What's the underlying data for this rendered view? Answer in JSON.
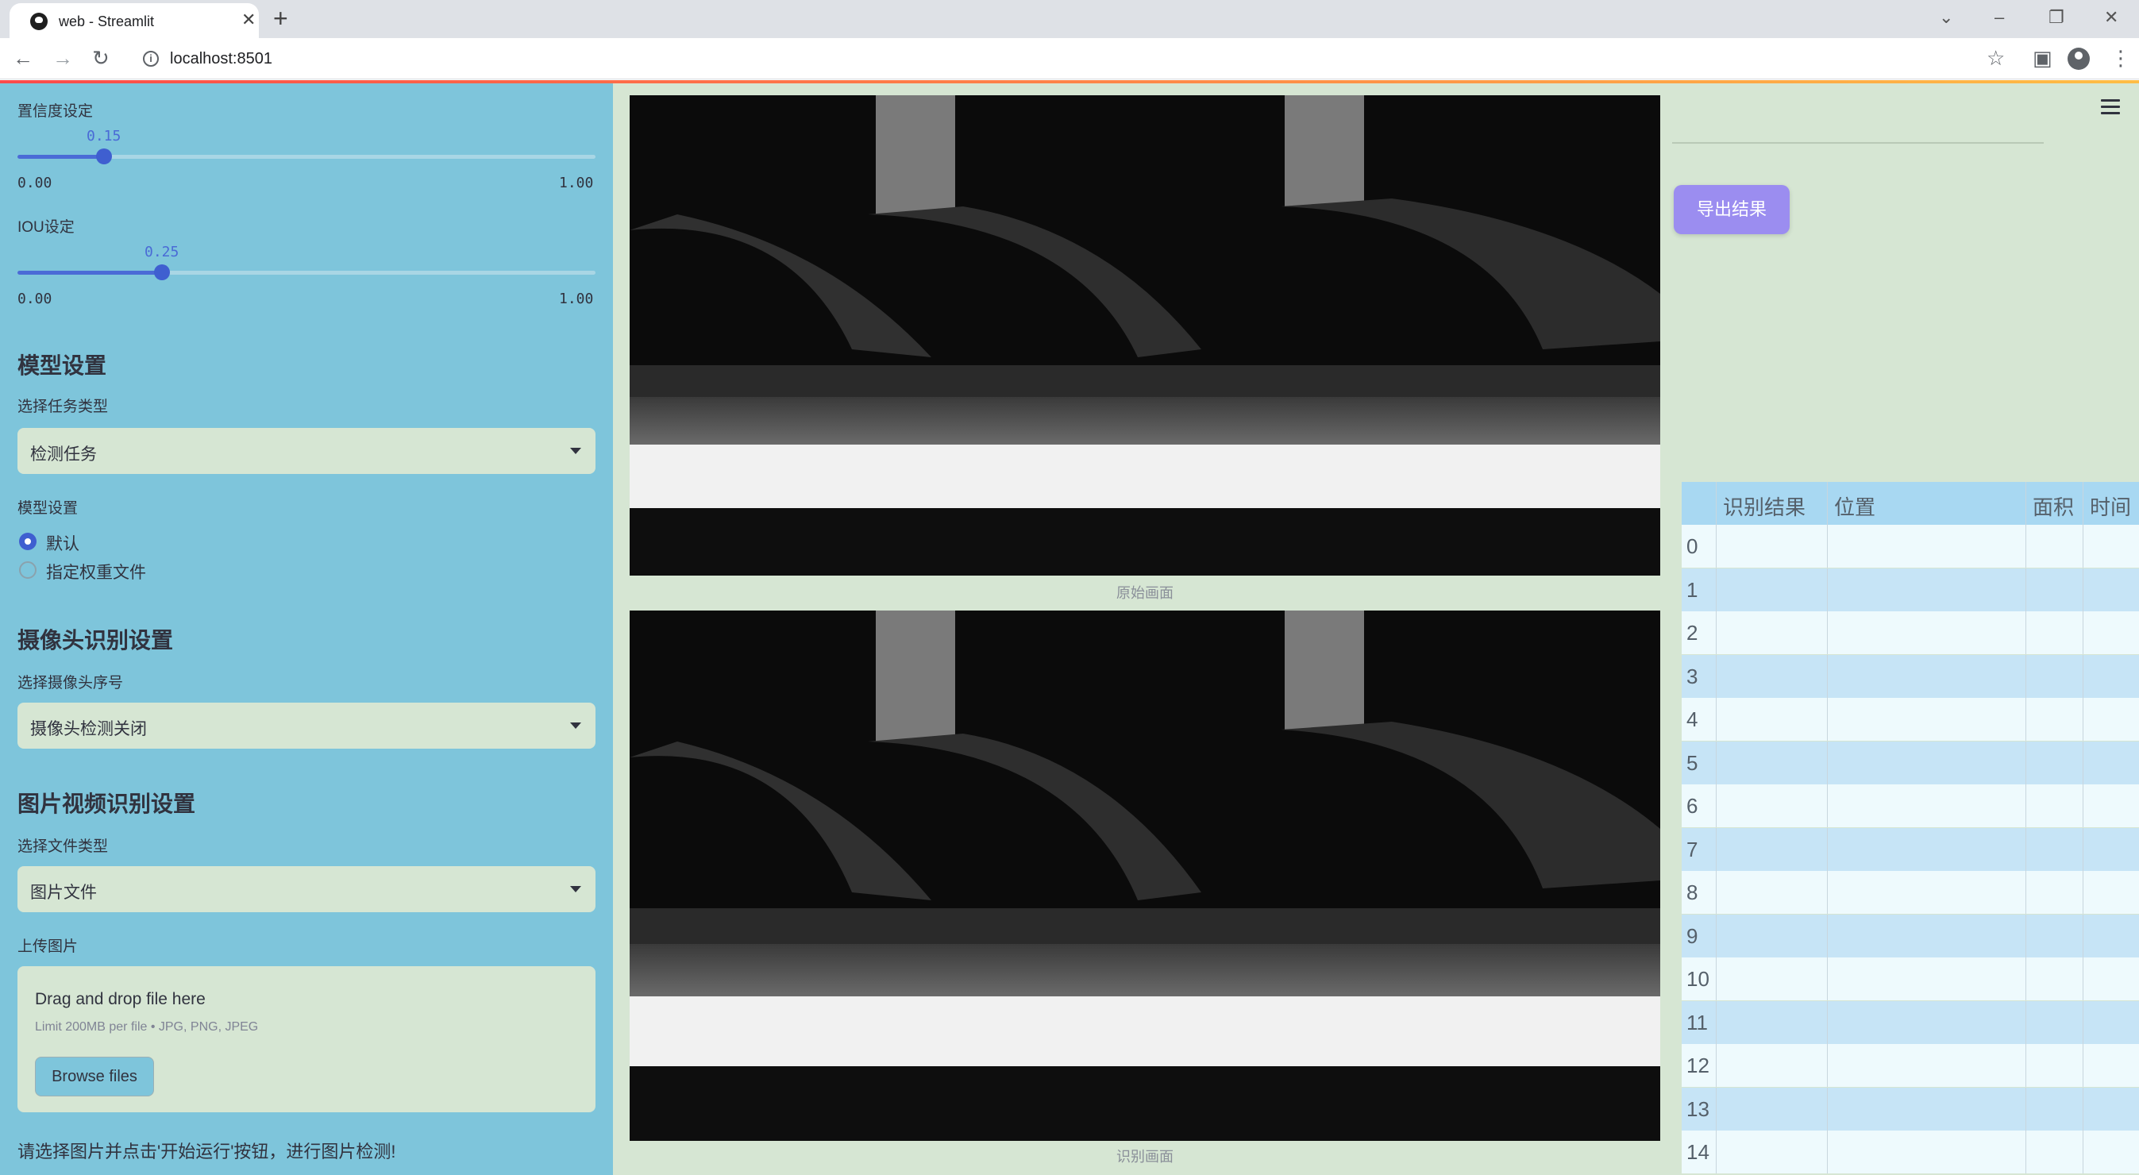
{
  "browser": {
    "tab_title": "web - Streamlit",
    "url": "localhost:8501"
  },
  "sidebar": {
    "confidence": {
      "label": "置信度设定",
      "value": "0.15",
      "min": "0.00",
      "max": "1.00",
      "fraction": 0.15
    },
    "iou": {
      "label": "IOU设定",
      "value": "0.25",
      "min": "0.00",
      "max": "1.00",
      "fraction": 0.25
    },
    "model_section": {
      "heading": "模型设置",
      "task_label": "选择任务类型",
      "task_value": "检测任务",
      "model_label": "模型设置",
      "options": [
        "默认",
        "指定权重文件"
      ],
      "selected_index": 0
    },
    "camera_section": {
      "heading": "摄像头识别设置",
      "camera_label": "选择摄像头序号",
      "camera_value": "摄像头检测关闭"
    },
    "media_section": {
      "heading": "图片视频识别设置",
      "filetype_label": "选择文件类型",
      "filetype_value": "图片文件",
      "upload_label": "上传图片",
      "drop_text": "Drag and drop file here",
      "drop_limit": "Limit 200MB per file • JPG, PNG, JPEG",
      "browse_label": "Browse files"
    },
    "hint": "请选择图片并点击'开始运行'按钮，进行图片检测!"
  },
  "main": {
    "original_caption": "原始画面",
    "result_caption": "识别画面"
  },
  "right": {
    "export_label": "导出结果",
    "table": {
      "columns": [
        "识别结果",
        "位置",
        "面积",
        "时间"
      ],
      "row_indices": [
        "0",
        "1",
        "2",
        "3",
        "4",
        "5",
        "6",
        "7",
        "8",
        "9",
        "10",
        "11",
        "12",
        "13",
        "14"
      ]
    }
  },
  "colors": {
    "sidebar_bg": "#7ec5db",
    "app_bg": "#d6e6d3",
    "accent": "#3f5fd0",
    "export_button": "#9b8df0",
    "table_header": "#a8d8f2",
    "row_even": "#eefafd",
    "row_odd": "#c6e4f6"
  }
}
